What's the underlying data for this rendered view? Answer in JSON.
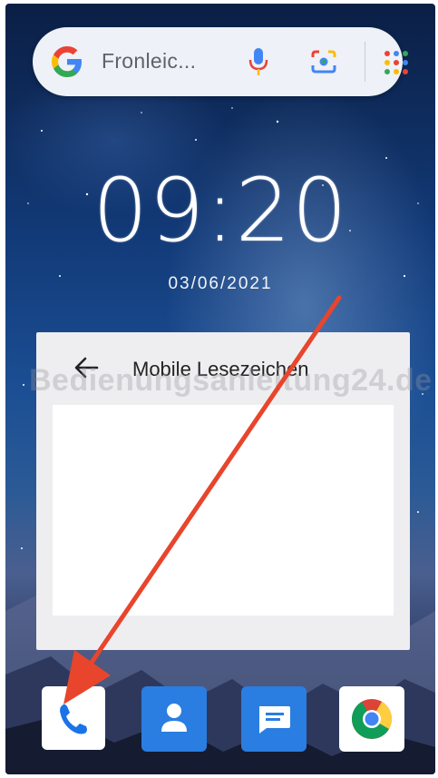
{
  "search": {
    "text": "Fronleic...",
    "google_icon": "google-g-icon",
    "mic_icon": "microphone-icon",
    "lens_icon": "google-lens-icon",
    "apps_icon": "apps-grid-icon"
  },
  "clock": {
    "time": "09:20",
    "date": "03/06/2021"
  },
  "widget": {
    "title": "Mobile Lesezeichen",
    "back_icon": "arrow-left-icon"
  },
  "watermark": "Bedienungsanleitung24.de",
  "dock": [
    {
      "name": "Phone",
      "icon": "phone-icon"
    },
    {
      "name": "Contacts",
      "icon": "contacts-icon"
    },
    {
      "name": "Messages",
      "icon": "messages-icon"
    },
    {
      "name": "Chrome",
      "icon": "chrome-icon"
    }
  ],
  "colors": {
    "annotation_arrow": "#e8452c",
    "dock_blue": "#2a7de1"
  }
}
